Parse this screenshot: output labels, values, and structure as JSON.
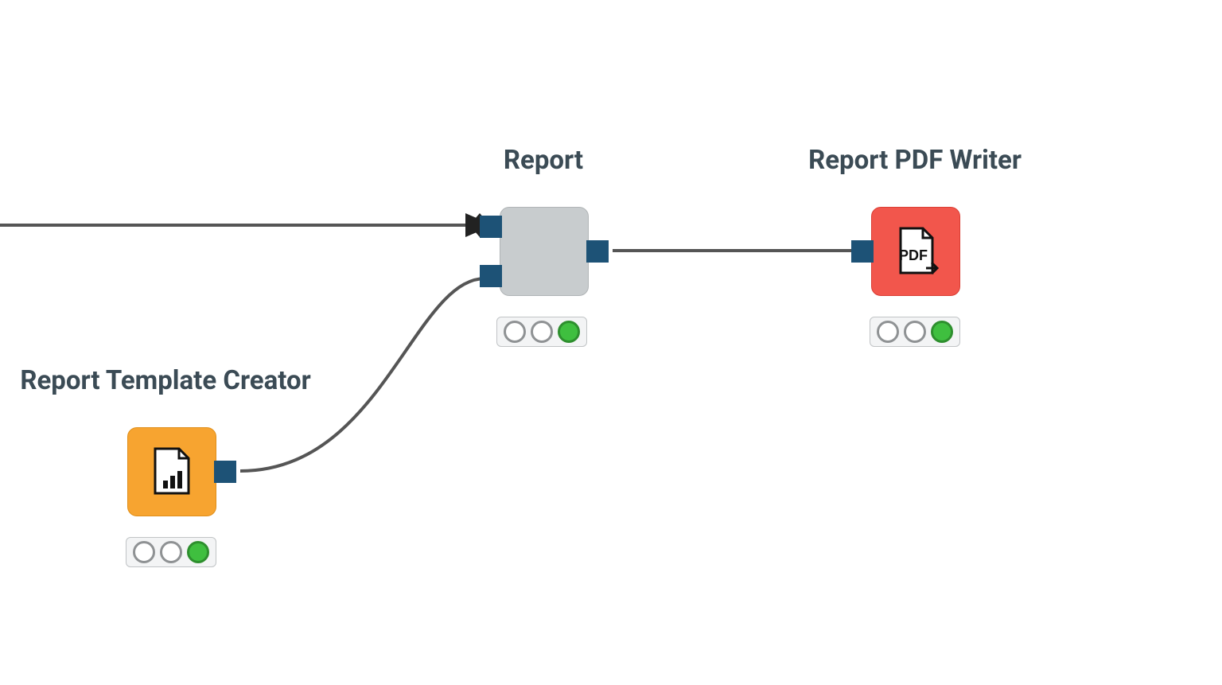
{
  "nodes": {
    "report": {
      "label": "Report",
      "status": [
        "off",
        "off",
        "green"
      ]
    },
    "pdf_writer": {
      "label": "Report PDF Writer",
      "status": [
        "off",
        "off",
        "green"
      ]
    },
    "template_creator": {
      "label": "Report Template Creator",
      "status": [
        "off",
        "off",
        "green"
      ]
    }
  },
  "colors": {
    "port": "#1d5276",
    "node_gray": "#c8ccce",
    "node_orange": "#f7a430",
    "node_red": "#f2564c",
    "wire": "#555555",
    "arrow": "#222222",
    "text": "#3b4b55"
  }
}
